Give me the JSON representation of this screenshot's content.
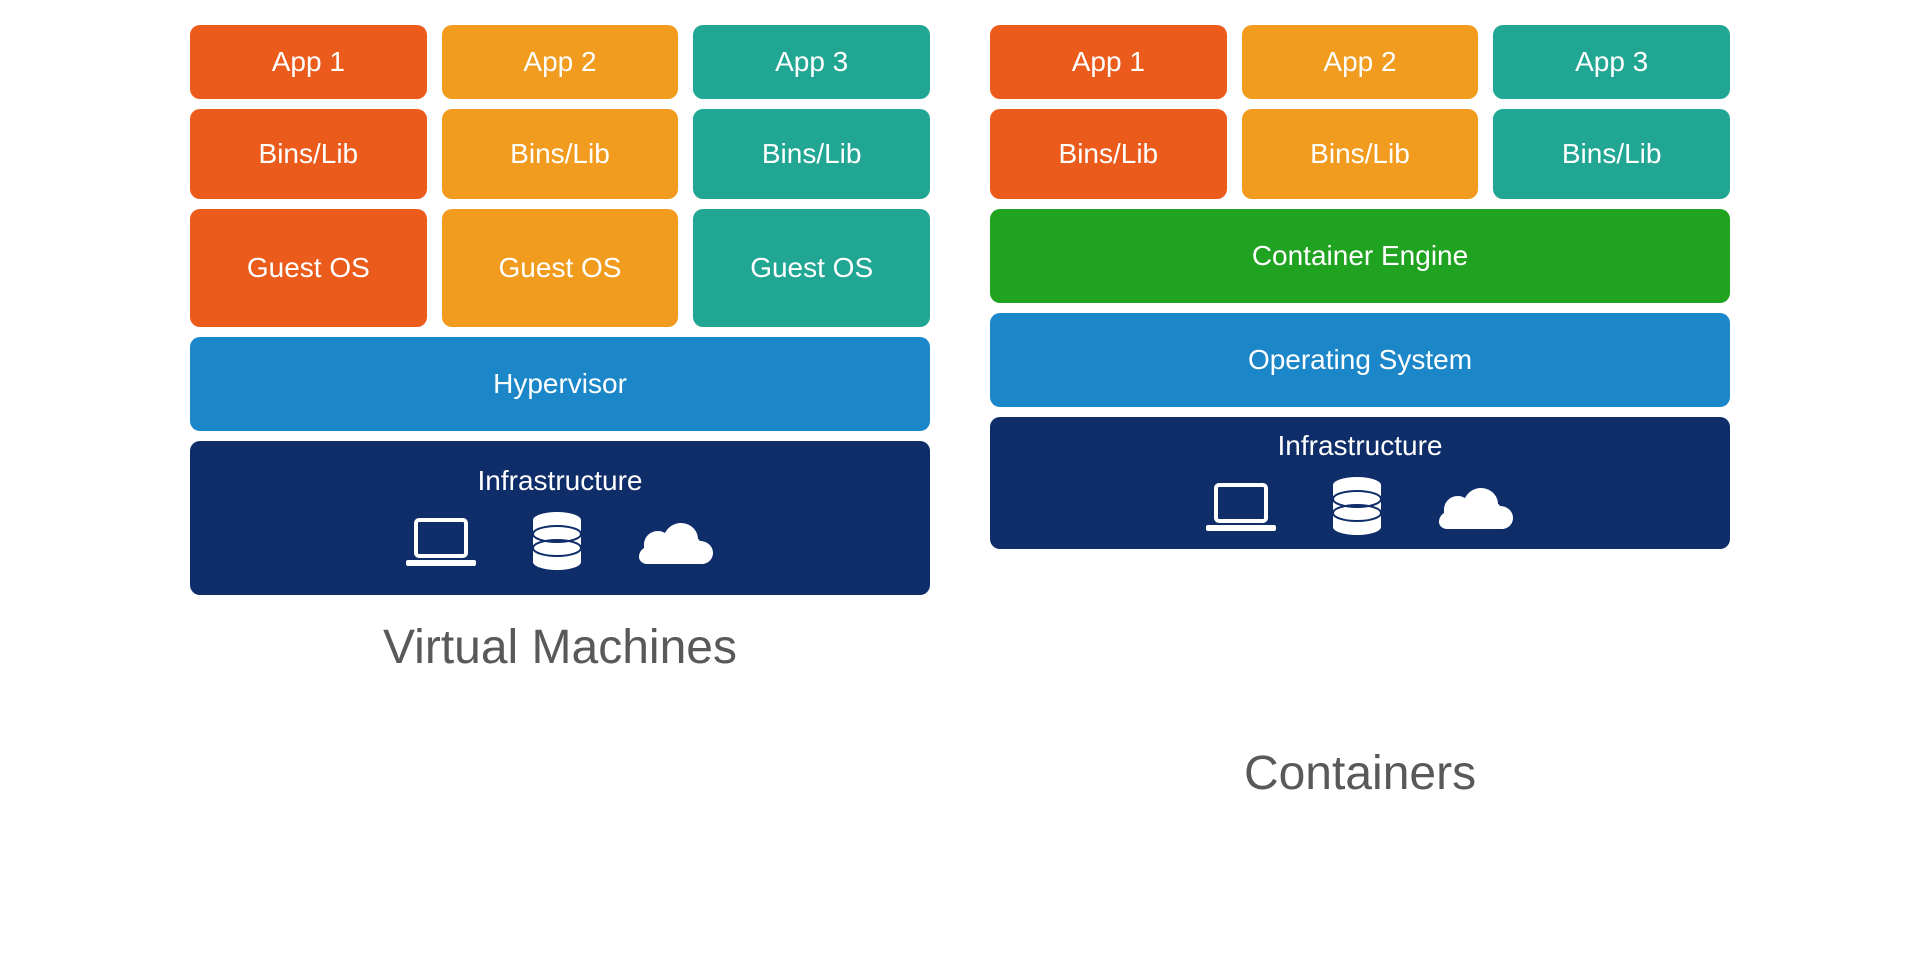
{
  "vm": {
    "title": "Virtual Machines",
    "columns": [
      {
        "app": "App 1",
        "libs": "Bins/Lib",
        "os": "Guest OS",
        "color": "orange"
      },
      {
        "app": "App 2",
        "libs": "Bins/Lib",
        "os": "Guest OS",
        "color": "amber"
      },
      {
        "app": "App 3",
        "libs": "Bins/Lib",
        "os": "Guest OS",
        "color": "teal"
      }
    ],
    "hypervisor": "Hypervisor",
    "infrastructure": "Infrastructure"
  },
  "containers": {
    "title": "Containers",
    "columns": [
      {
        "app": "App 1",
        "libs": "Bins/Lib",
        "color": "orange"
      },
      {
        "app": "App 2",
        "libs": "Bins/Lib",
        "color": "amber"
      },
      {
        "app": "App 3",
        "libs": "Bins/Lib",
        "color": "teal"
      }
    ],
    "engine": "Container Engine",
    "os": "Operating System",
    "infrastructure": "Infrastructure"
  }
}
